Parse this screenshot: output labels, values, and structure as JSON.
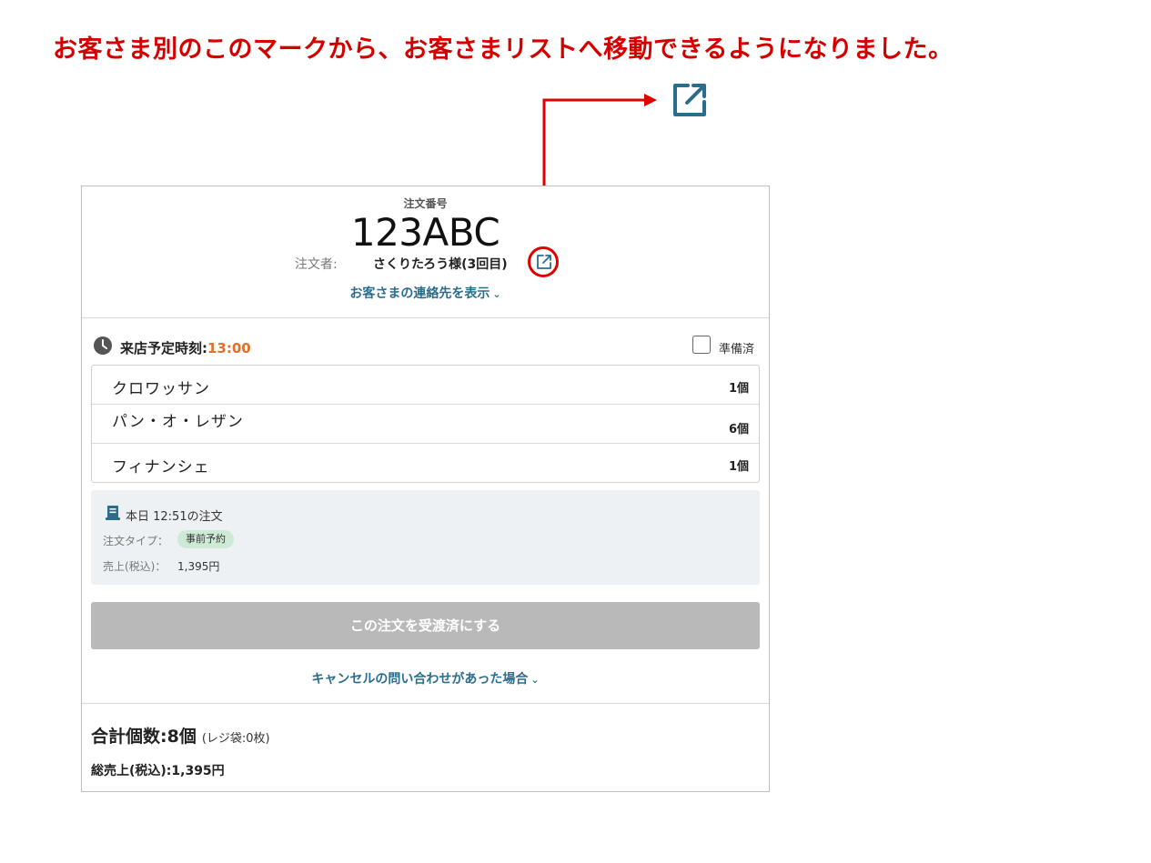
{
  "headline": "お客さま別のこのマークから、お客さまリストへ移動できるようになりました。",
  "icons": {
    "external_link": "external-link-icon",
    "clock": "clock-icon",
    "receipt": "receipt-icon",
    "chevron": "chevron-down-icon"
  },
  "colors": {
    "annotation_red": "#e00000",
    "link_teal": "#2b6e8c",
    "time_orange": "#e0702a",
    "badge_green": "#cfe9d7",
    "disabled_button": "#b9b9b9"
  },
  "order": {
    "number_label": "注文番号",
    "number": "123ABC",
    "orderer_label": "注文者:",
    "orderer_name": "さくりたろう様(3回目)",
    "contact_link": "お客さまの連絡先を表示"
  },
  "visit": {
    "label": "来店予定時刻:",
    "time": "13:00",
    "ready_label": "準備済",
    "ready_checked": false
  },
  "items": [
    {
      "name": "クロワッサン",
      "qty": "1個"
    },
    {
      "name": "パン・オ・レザン",
      "qty": "6個"
    },
    {
      "name": "フィナンシェ",
      "qty": "1個"
    }
  ],
  "info": {
    "order_time": "本日 12:51の注文",
    "type_label": "注文タイプ：",
    "type_value": "事前予約",
    "sales_label": "売上(税込)：",
    "sales_value": "1,395円"
  },
  "actions": {
    "complete_button": "この注文を受渡済にする",
    "cancel_link": "キャンセルの問い合わせがあった場合"
  },
  "totals": {
    "count": "合計個数:8個",
    "bag": "(レジ袋:0枚)",
    "sales": "総売上(税込):1,395円"
  }
}
